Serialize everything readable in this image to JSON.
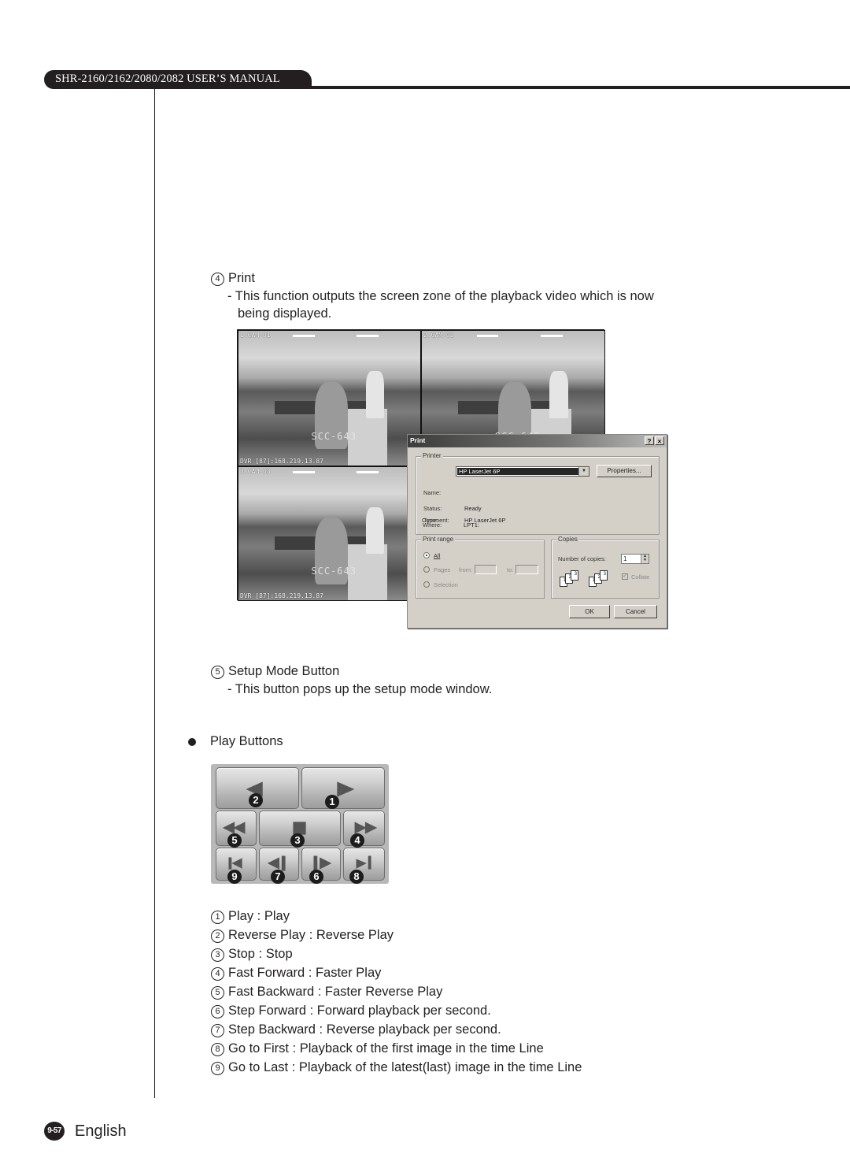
{
  "header": {
    "title": "SHR-2160/2162/2080/2082 USER’S MANUAL"
  },
  "sections": {
    "print": {
      "number": "4",
      "title": "Print",
      "desc_line1": "- This function outputs the screen zone of the playback video which is now",
      "desc_line2": "being displayed."
    },
    "setup": {
      "number": "5",
      "title": "Setup Mode Button",
      "desc": "- This button pops up the setup mode window."
    },
    "play_buttons": {
      "title": "Play Buttons"
    }
  },
  "screenshot": {
    "cameras": [
      {
        "label": "1.CAM-01",
        "model": "SCC-643",
        "footer": "DVR [87]:168.219.13.87"
      },
      {
        "label": "2.CAM-02",
        "model": "SCC-643",
        "footer": ""
      },
      {
        "label": "3.CAM-03",
        "model": "SCC-643",
        "footer": "DVR [87]:168.219.13.87"
      }
    ],
    "print_dialog": {
      "title": "Print",
      "help_button": "?",
      "close_button": "×",
      "printer_group": "Printer",
      "name_label": "Name:",
      "name_value": "HP LaserJet 6P",
      "properties_button": "Properties...",
      "status_label": "Status:",
      "status_value": "Ready",
      "type_label": "Type:",
      "type_value": "HP LaserJet 6P",
      "where_label": "Where:",
      "where_value": "LPT1:",
      "comment_label": "Comment:",
      "comment_value": "",
      "range_group": "Print range",
      "range_all": "All",
      "range_pages": "Pages",
      "range_from": "from:",
      "range_to": "to:",
      "range_selection": "Selection",
      "copies_group": "Copies",
      "copies_label": "Number of copies:",
      "copies_value": "1",
      "collate_label": "Collate",
      "collate_checked": true,
      "selected_range": "All",
      "ok_button": "OK",
      "cancel_button": "Cancel"
    }
  },
  "play_panel": {
    "buttons": [
      {
        "number": "2",
        "action": "reverse-play"
      },
      {
        "number": "1",
        "action": "play"
      },
      {
        "number": "5",
        "action": "fast-backward"
      },
      {
        "number": "3",
        "action": "stop"
      },
      {
        "number": "4",
        "action": "fast-forward"
      },
      {
        "number": "9",
        "action": "go-to-last"
      },
      {
        "number": "7",
        "action": "step-backward"
      },
      {
        "number": "6",
        "action": "step-forward"
      },
      {
        "number": "8",
        "action": "go-to-first"
      }
    ]
  },
  "legend": [
    {
      "number": "1",
      "text": "Play : Play"
    },
    {
      "number": "2",
      "text": "Reverse Play : Reverse Play"
    },
    {
      "number": "3",
      "text": "Stop : Stop"
    },
    {
      "number": "4",
      "text": "Fast Forward : Faster Play"
    },
    {
      "number": "5",
      "text": "Fast Backward : Faster Reverse Play"
    },
    {
      "number": "6",
      "text": "Step Forward : Forward playback per second."
    },
    {
      "number": "7",
      "text": "Step Backward : Reverse playback per second."
    },
    {
      "number": "8",
      "text": "Go to First : Playback of the first image in the time Line"
    },
    {
      "number": "9",
      "text": "Go to Last : Playback of the latest(last) image in the time Line"
    }
  ],
  "footer": {
    "page_number": "9-57",
    "language": "English"
  }
}
